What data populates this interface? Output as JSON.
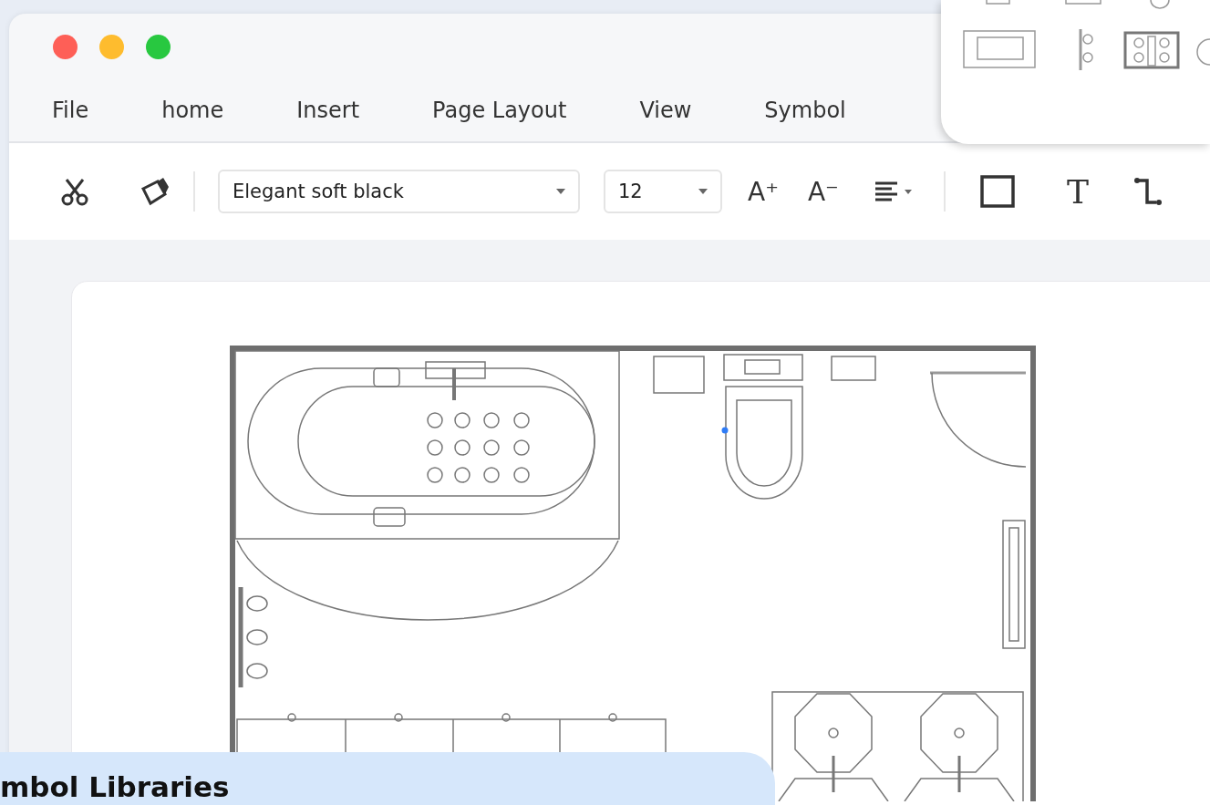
{
  "window": {
    "buttons": [
      {
        "color": "#fe5f57"
      },
      {
        "color": "#febc2e"
      },
      {
        "color": "#28c840"
      }
    ]
  },
  "menu": [
    "File",
    "home",
    "Insert",
    "Page Layout",
    "View",
    "Symbol"
  ],
  "toolbar": {
    "font_field": {
      "value": "Elegant soft black"
    },
    "size_field": {
      "value": "12"
    },
    "grow_font": "A⁺",
    "shrink_font": "A⁻",
    "text_tool": "T"
  },
  "callout": {
    "title": "mbol Libraries"
  }
}
